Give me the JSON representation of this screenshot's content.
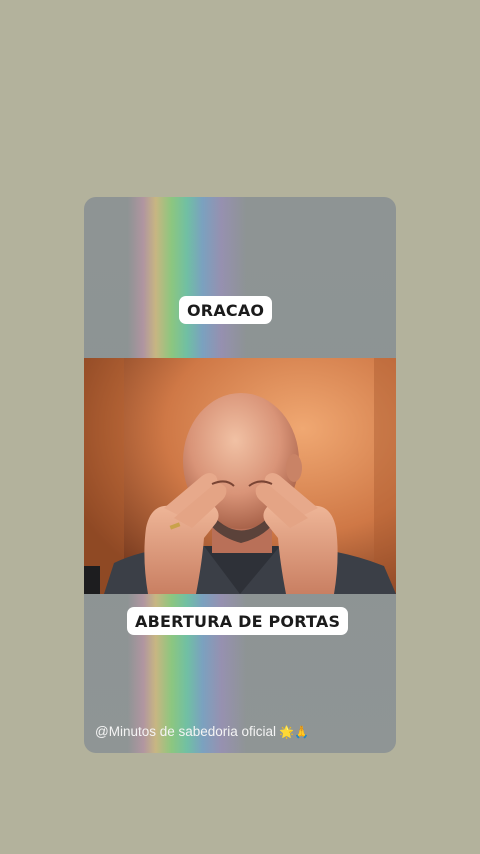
{
  "story": {
    "title_caption": "ORACAO",
    "subtitle_caption": "ABERTURA DE PORTAS",
    "watermark": "@Minutos de sabedoria oficial",
    "watermark_emojis": "🌟🙏"
  },
  "colors": {
    "page_background": "#b3b29c",
    "card_background": "#8e9494",
    "caption_background": "#ffffff",
    "caption_text": "#1b1b1b",
    "video_background": "#c97343"
  }
}
